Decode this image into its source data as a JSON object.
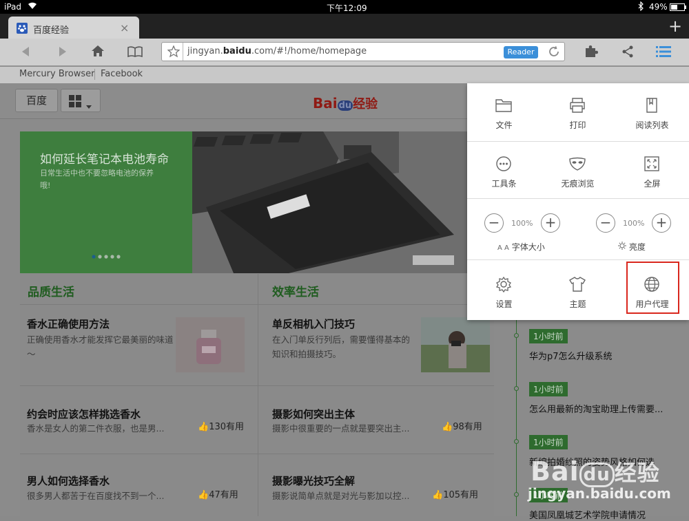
{
  "status": {
    "device": "iPad",
    "time": "下午12:09",
    "battery": "49%"
  },
  "browser": {
    "tab_title": "百度经验",
    "url_host_prefix": "jingyan.",
    "url_host_bold": "baidu",
    "url_rest": ".com/#!/home/homepage",
    "reader_label": "Reader",
    "bookmarks": [
      "Mercury Browser",
      "Facebook"
    ]
  },
  "site": {
    "home_label": "百度",
    "logo_red": "Bai",
    "logo_paw": "du",
    "logo_text": "经验",
    "banner": {
      "title": "如何延长笔记本电池寿命",
      "subtitle": "日常生活中也不要忽略电池的保养哦!"
    },
    "sections": [
      {
        "title": "品质生活",
        "articles": [
          {
            "title": "香水正确使用方法",
            "desc": "正确使用香水才能发挥它最美丽的味道～"
          },
          {
            "title": "约会时应该怎样挑选香水",
            "desc": "香水是女人的第二件衣服，也是男...",
            "count": "130有用"
          },
          {
            "title": "男人如何选择香水",
            "desc": "很多男人都苦于在百度找不到一个...",
            "count": "47有用"
          }
        ]
      },
      {
        "title": "效率生活",
        "articles": [
          {
            "title": "单反相机入门技巧",
            "desc": "在入门单反行列后，需要懂得基本的知识和拍摄技巧。"
          },
          {
            "title": "摄影如何突出主体",
            "desc": "摄影中很重要的一点就是要突出主...",
            "count": "98有用"
          },
          {
            "title": "摄影曝光技巧全解",
            "desc": "摄影说简单点就是对光与影加以控...",
            "count": "105有用"
          }
        ]
      }
    ],
    "timeline": [
      {
        "badge": "1小时前",
        "text": "华为p7怎么升级系统"
      },
      {
        "badge": "1小时前",
        "text": "怎么用最新的淘宝助理上传需要..."
      },
      {
        "badge": "1小时前",
        "text": "新编拍婚纱照的姿势风格如何选"
      },
      {
        "badge": "1小时前",
        "text": "美国凤凰城艺术学院申请情况"
      }
    ],
    "watermark": {
      "brand": "Bai",
      "brand_paw": "du",
      "brand_text": "经验",
      "url": "jingyan.baidu.com"
    }
  },
  "menu": {
    "row1": [
      "文件",
      "打印",
      "阅读列表"
    ],
    "row2": [
      "工具条",
      "无痕浏览",
      "全屏"
    ],
    "font_pct": "100%",
    "font_label": "字体大小",
    "font_glyph": "A A",
    "bright_pct": "100%",
    "bright_label": "亮度",
    "row4": [
      "设置",
      "主题",
      "用户代理"
    ]
  },
  "colors": {
    "accent_green": "#2e7d32",
    "highlight_red": "#d9261c",
    "reader_blue": "#3b8fd9"
  }
}
